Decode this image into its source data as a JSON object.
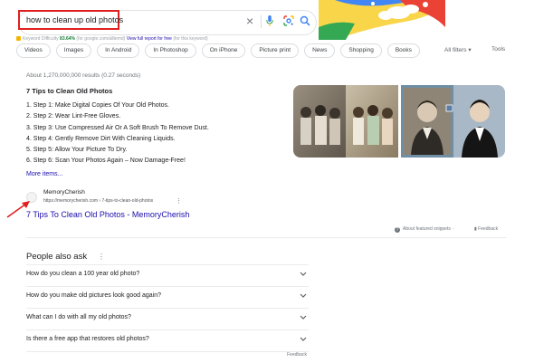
{
  "search": {
    "query": "how to clean up old photos",
    "clear_icon": "close-icon",
    "mic_icon": "microphone-icon",
    "lens_icon": "google-lens-icon",
    "search_icon": "search-icon"
  },
  "keyword_bar": {
    "label": "Keyword Difficulty",
    "difficulty": "83.64%",
    "middle_text": "(for google.com/alltemd)",
    "link_text": "View full report for free",
    "end_text": "(for this keyword)"
  },
  "chips": [
    "Videos",
    "Images",
    "In Android",
    "In Photoshop",
    "On iPhone",
    "Picture print",
    "News",
    "Shopping",
    "Books"
  ],
  "all_filters_label": "All filters",
  "tools_label": "Tools",
  "result_stats": "About 1,270,000,000 results (0.27 seconds)",
  "snippet": {
    "title": "7 Tips to Clean Old Photos",
    "steps": [
      "1. Step 1: Make Digital Copies Of Your Old Photos.",
      "2. Step 2: Wear Lint-Free Gloves.",
      "3. Step 3: Use Compressed Air Or A Soft Brush To Remove Dust.",
      "4. Step 4: Gently Remove Dirt With Cleaning Liquids.",
      "5. Step 5: Allow Your Picture To Dry.",
      "6. Step 6: Scan Your Photos Again – Now Damage-Free!"
    ],
    "more_items": "More items...",
    "source": {
      "site_name": "MemoryCherish",
      "url": "https://memorycherish.com › 7-tips-to-clean-old-photos",
      "link_title": "7 Tips To Clean Old Photos - MemoryCherish"
    }
  },
  "about_snippets": "About featured snippets",
  "feedback_label": "Feedback",
  "people_also_ask": {
    "title": "People also ask",
    "questions": [
      "How do you clean a 100 year old photo?",
      "How do you make old pictures look good again?",
      "What can I do with all my old photos?",
      "Is there a free app that restores old photos?"
    ]
  },
  "colors": {
    "link": "#1a0dab",
    "highlight_box": "#e02020",
    "google_blue": "#4285f4",
    "google_red": "#ea4335",
    "google_yellow": "#fbbc04",
    "google_green": "#34a853"
  }
}
